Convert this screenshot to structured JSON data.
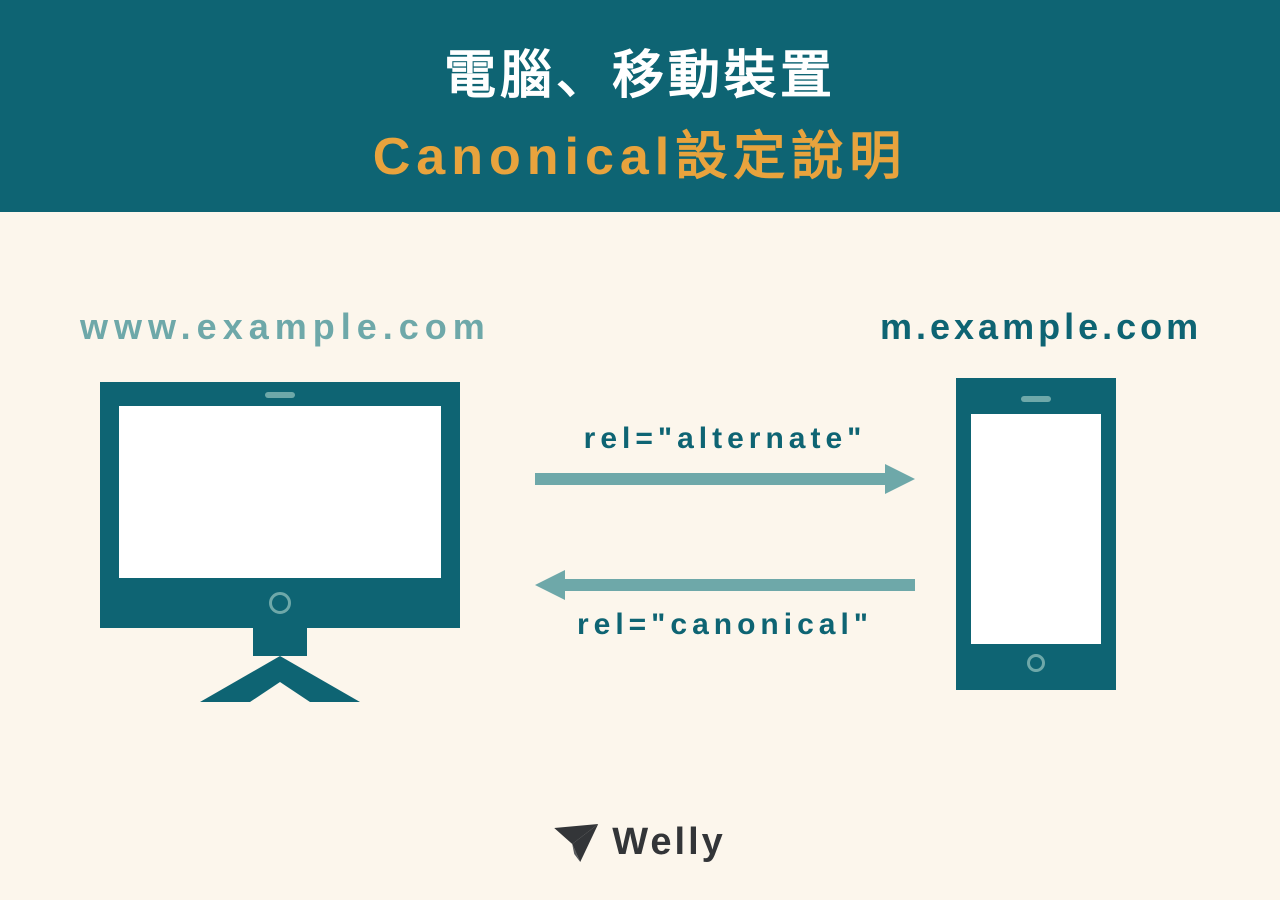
{
  "header": {
    "line1": "電腦、移動裝置",
    "line2": "Canonical設定說明"
  },
  "labels": {
    "desktop_url": "www.example.com",
    "mobile_url": "m.example.com",
    "rel_alternate": "rel=\"alternate\"",
    "rel_canonical": "rel=\"canonical\""
  },
  "brand": {
    "name": "Welly"
  },
  "colors": {
    "header_bg": "#0e6473",
    "accent": "#e8a33d",
    "arrow": "#6ea8a9",
    "page_bg": "#fcf6ec"
  }
}
